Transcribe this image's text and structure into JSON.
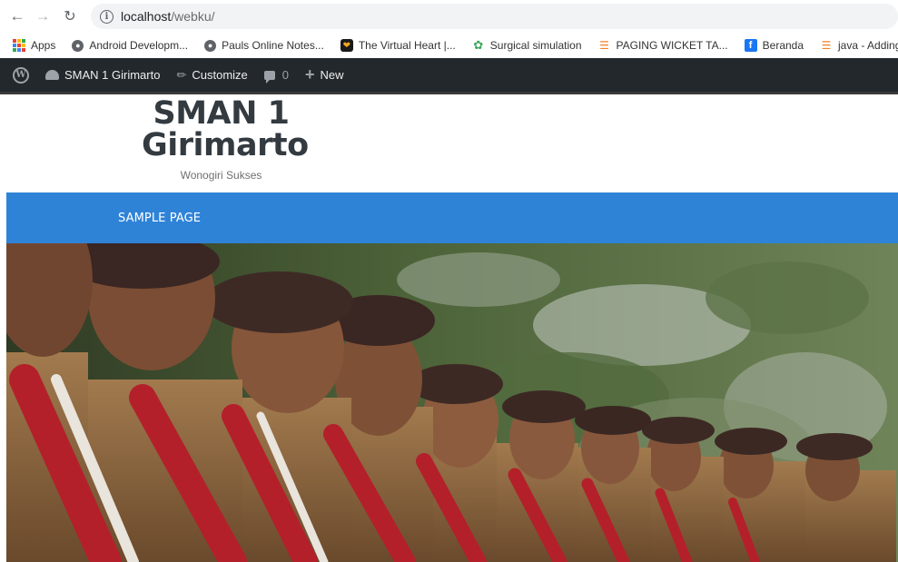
{
  "browser": {
    "url_host": "localhost",
    "url_path": "/webku/",
    "icons": {
      "back": "arrow-left-icon",
      "forward": "arrow-right-icon",
      "reload": "reload-icon",
      "info": "info-icon"
    }
  },
  "bookmarks": [
    {
      "label": "Apps",
      "icon": "apps-grid-icon"
    },
    {
      "label": "Android Developm...",
      "icon": "globe-icon"
    },
    {
      "label": "Pauls Online Notes...",
      "icon": "globe-icon"
    },
    {
      "label": "The Virtual Heart |...",
      "icon": "virtual-heart-icon"
    },
    {
      "label": "Surgical simulation",
      "icon": "surgical-icon"
    },
    {
      "label": "PAGING WICKET TA...",
      "icon": "stackoverflow-icon"
    },
    {
      "label": "Beranda",
      "icon": "facebook-icon"
    },
    {
      "label": "java - Adding u",
      "icon": "stackoverflow-icon"
    }
  ],
  "admin_bar": {
    "site_name": "SMAN 1 Girimarto",
    "customize": "Customize",
    "comments_count": "0",
    "new_label": "New",
    "colors": {
      "background": "#23282d",
      "icon": "#9ca2a7"
    }
  },
  "site": {
    "title_line1": "SMAN 1",
    "title_line2": "Girimarto",
    "tagline": "Wonogiri Sukses"
  },
  "nav": {
    "items": [
      "SAMPLE PAGE"
    ],
    "color": "#2f83d7"
  }
}
